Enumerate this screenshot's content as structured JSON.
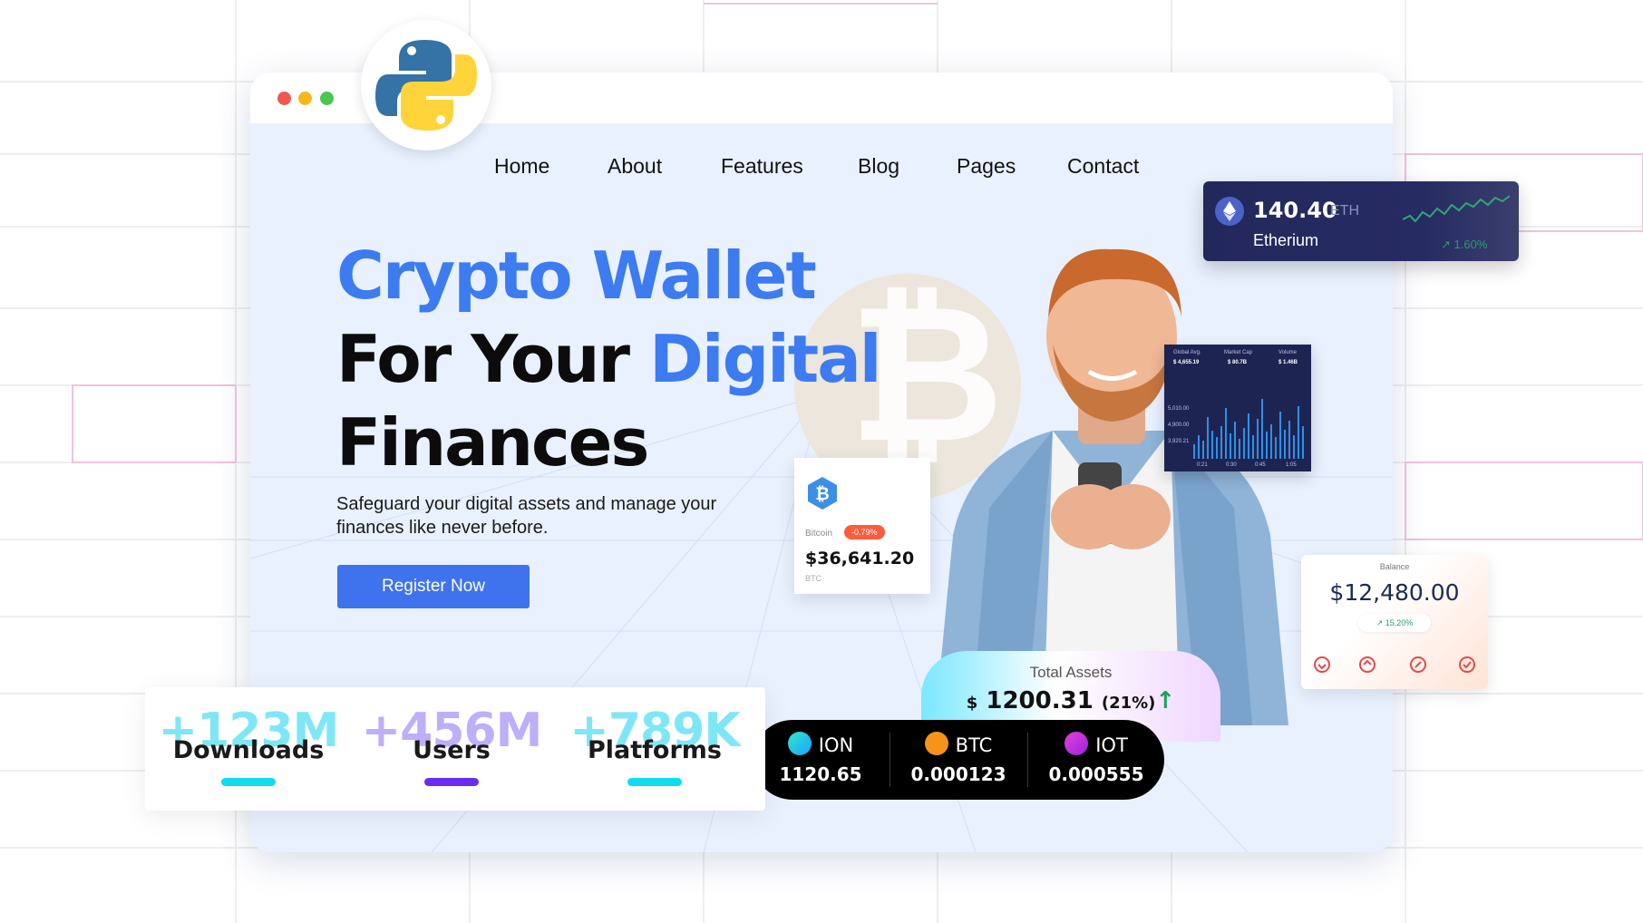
{
  "nav": {
    "items": [
      "Home",
      "About",
      "Features",
      "Blog",
      "Pages",
      "Contact"
    ]
  },
  "hero": {
    "line1": "Crypto Wallet",
    "line2_black": "For Your ",
    "line2_blue": "Digital",
    "line3": "Finances",
    "subtitle": "Safeguard your digital assets and manage your finances like never before.",
    "cta_label": "Register Now"
  },
  "btc_card": {
    "name": "Bitcoin",
    "change": "-0.79%",
    "price": "$36,641.20",
    "symbol": "BTC"
  },
  "mini_chart": {
    "labels": [
      "Global Avg.",
      "Market Cap",
      "Volume"
    ],
    "values": [
      "$ 4,655.19",
      "$ 80.7B",
      "$ 1.46B"
    ],
    "y_ticks": [
      "5,010.00",
      "4,900.00",
      "3,920.21"
    ],
    "x_ticks": [
      "0:21",
      "0:30",
      "0:45",
      "1:05"
    ]
  },
  "eth_card": {
    "price": "140.40",
    "symbol": "ETH",
    "name": "Etherium",
    "change": "1.60%"
  },
  "balance_card": {
    "label": "Balance",
    "value": "$12,480.00",
    "change": "15.20%"
  },
  "total_assets": {
    "label": "Total Assets",
    "currency": "$",
    "value": "1200.31",
    "change": "(21%)"
  },
  "ticker": [
    {
      "symbol": "ION",
      "value": "1120.65"
    },
    {
      "symbol": "BTC",
      "value": "0.000123"
    },
    {
      "symbol": "IOT",
      "value": "0.000555"
    }
  ],
  "stats": [
    {
      "number": "+123M",
      "label": "Downloads"
    },
    {
      "number": "+456M",
      "label": "Users"
    },
    {
      "number": "+789K",
      "label": "Platforms"
    }
  ],
  "colors": {
    "accent_blue": "#3d7bf0",
    "button_blue": "#3f73ee",
    "cyan": "#12dbf0",
    "purple": "#6a2cf0"
  }
}
